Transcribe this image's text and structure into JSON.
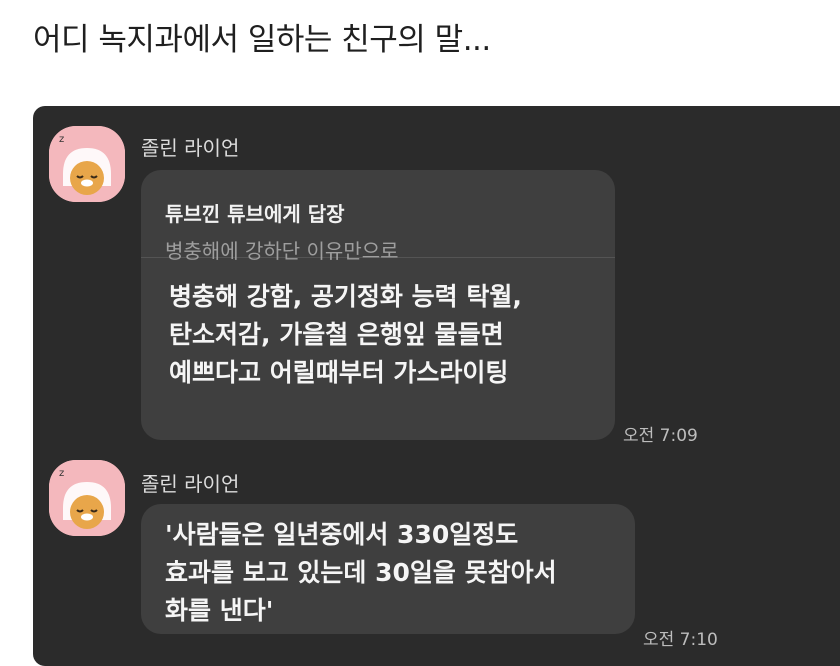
{
  "post": {
    "title": "어디 녹지과에서 일하는 친구의 말..."
  },
  "messages": [
    {
      "sender": "졸린 라이언",
      "reply": {
        "to": "튜브낀 튜브에게 답장",
        "quote": "병충해에 강하단 이유만으로"
      },
      "lines": [
        "병충해 강함, 공기정화 능력 탁월,",
        "탄소저감, 가을철 은행잎 물들면",
        "예쁘다고 어릴때부터 가스라이팅"
      ],
      "time": "오전 7:09"
    },
    {
      "sender": "졸린 라이언",
      "lines": [
        "'사람들은 일년중에서 330일정도",
        "효과를 보고 있는데 30일을 못참아서",
        "화를 낸다'"
      ],
      "time": "오전 7:10"
    }
  ],
  "avatar_icon": "sleeping-ryan-icon",
  "colors": {
    "panel": "#2b2b2b",
    "bubble": "#3f3f3f",
    "avatar_bg": "#f4b8bd"
  }
}
